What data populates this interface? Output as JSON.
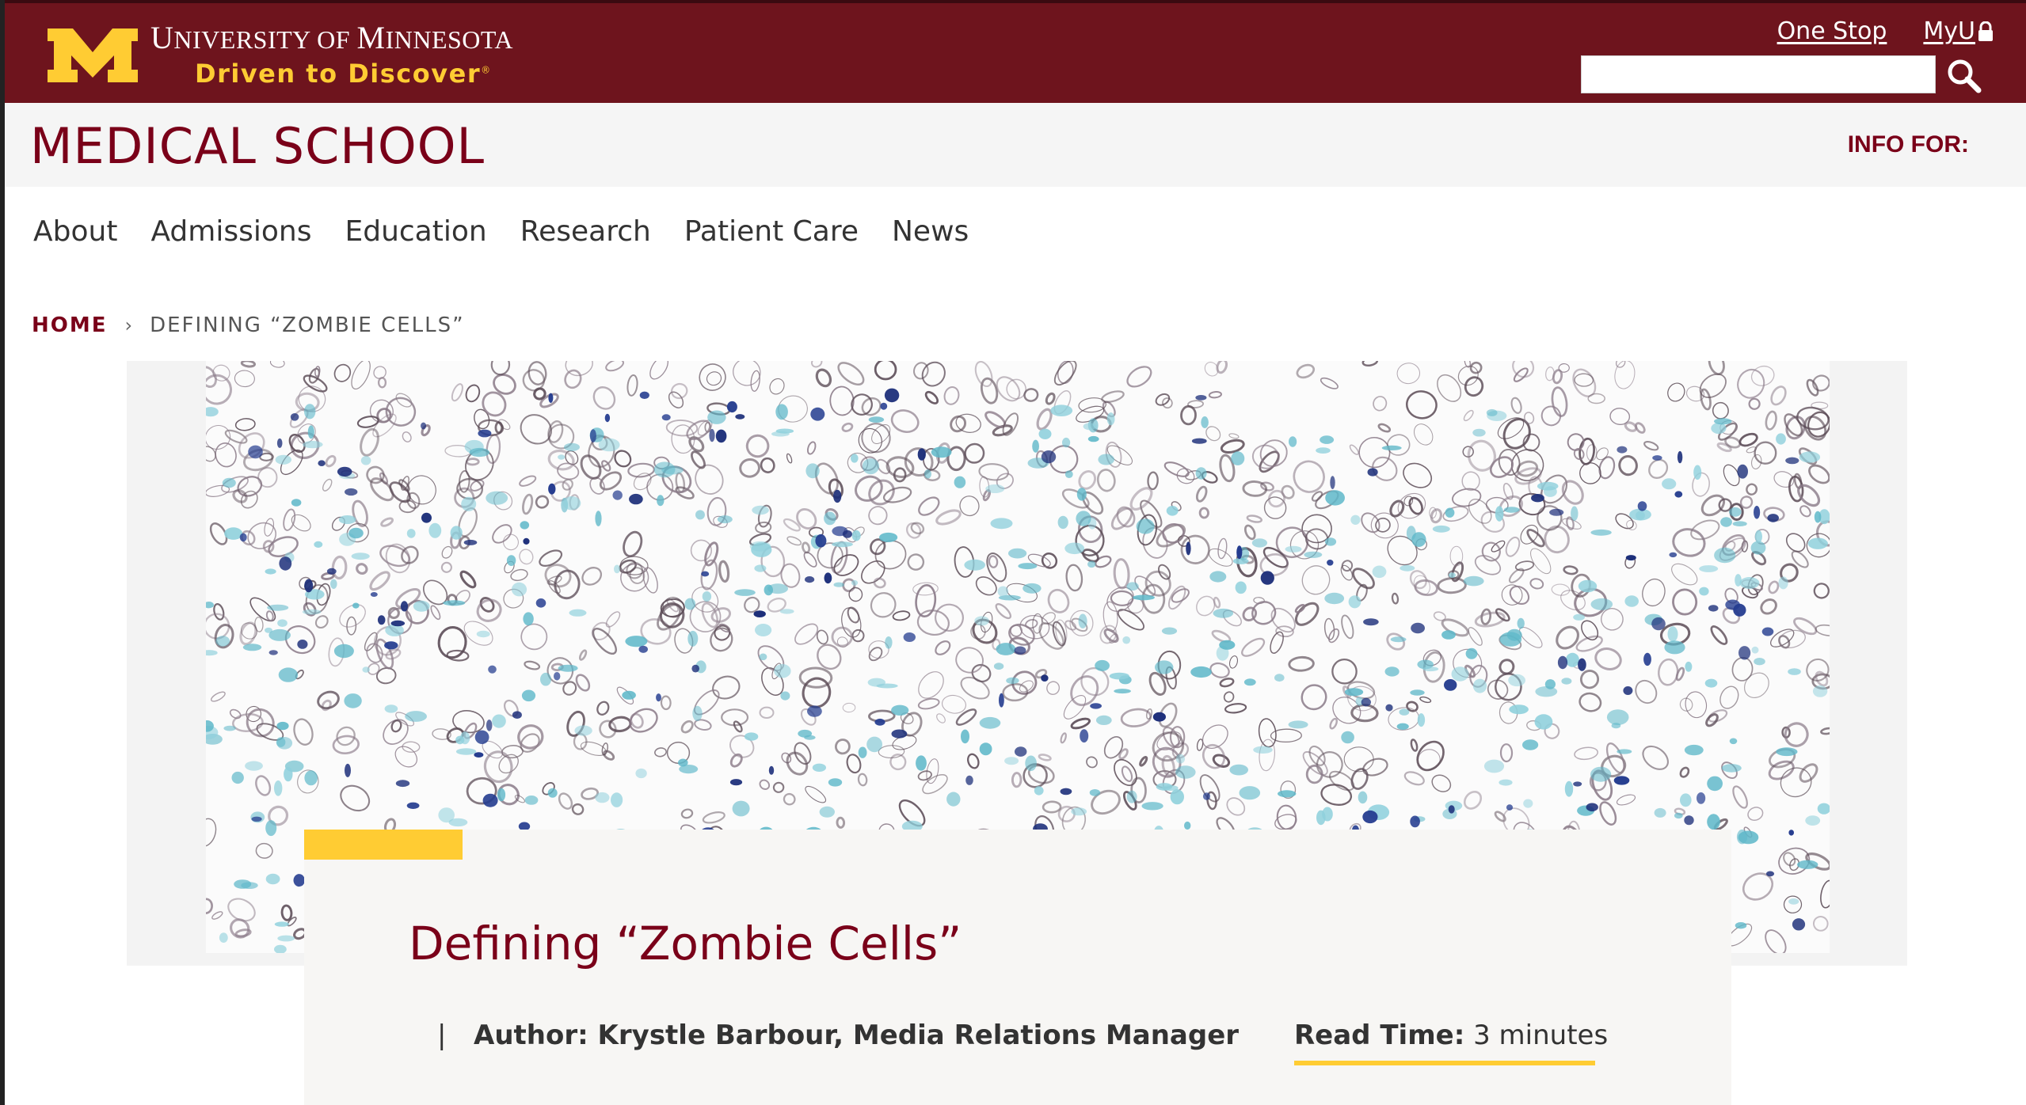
{
  "header": {
    "university_name_prefix": "U",
    "university_name_1": "NIVERSITY OF ",
    "university_name_2": "M",
    "university_name_3": "INNESOTA",
    "tagline": "Driven to Discover",
    "tagline_mark": "®",
    "links": {
      "one_stop": "One Stop",
      "myu": "MyU"
    },
    "search": {
      "placeholder": ""
    },
    "colors": {
      "maroon": "#6e141d",
      "gold": "#ffcc33"
    }
  },
  "unit": {
    "title": "MEDICAL SCHOOL",
    "info_for": "INFO FOR:"
  },
  "nav": {
    "items": [
      "About",
      "Admissions",
      "Education",
      "Research",
      "Patient Care",
      "News"
    ]
  },
  "breadcrumb": {
    "home": "HOME",
    "separator": "›",
    "current": "DEFINING “ZOMBIE CELLS”"
  },
  "hero": {
    "image_description_icon": "microscopy-stained-tissue-image"
  },
  "article": {
    "title": "Defining “Zombie Cells”",
    "pipe": "|",
    "author": "Author: Krystle Barbour, Media Relations Manager",
    "read_time_label": "Read Time:",
    "read_time_value": "3 minutes"
  }
}
